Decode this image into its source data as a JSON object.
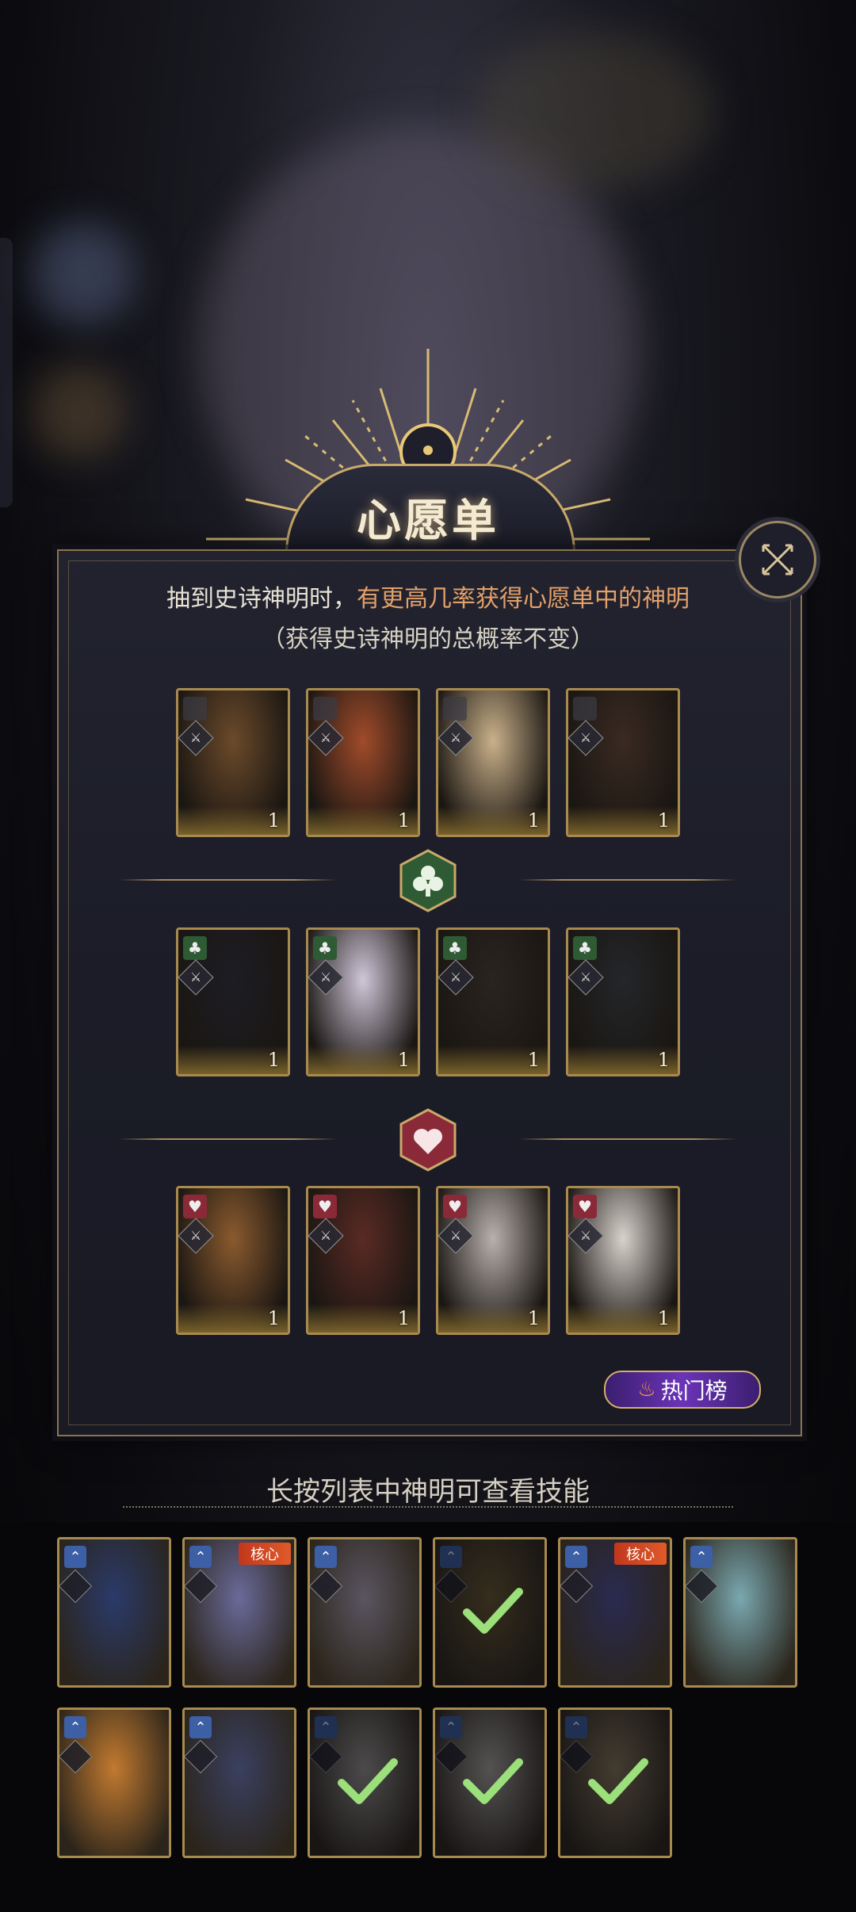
{
  "title": "心愿单",
  "description": {
    "line1_normal": "抽到史诗神明时，",
    "line1_highlight": "有更高几率获得心愿单中的神明",
    "line2": "（获得史诗神明的总概率不变）"
  },
  "wishlist_rows": [
    {
      "suit": "none",
      "cards": [
        {
          "count": "1",
          "tone": "#6b4a2a"
        },
        {
          "count": "1",
          "tone": "#a04b2a"
        },
        {
          "count": "1",
          "tone": "#c9b08a"
        },
        {
          "count": "1",
          "tone": "#3a2a22"
        }
      ]
    },
    {
      "suit": "club",
      "cards": [
        {
          "count": "1",
          "tone": "#1d1d24"
        },
        {
          "count": "1",
          "tone": "#cfc6d8"
        },
        {
          "count": "1",
          "tone": "#2a2420"
        },
        {
          "count": "1",
          "tone": "#24262a"
        }
      ]
    },
    {
      "suit": "heart",
      "cards": [
        {
          "count": "1",
          "tone": "#8a5a2e"
        },
        {
          "count": "1",
          "tone": "#5a2a24"
        },
        {
          "count": "1",
          "tone": "#b8b0ac"
        },
        {
          "count": "1",
          "tone": "#d8d2cc"
        }
      ]
    }
  ],
  "hot_list_button": "热门榜",
  "hint": "长按列表中神明可查看技能",
  "core_badge": "核心",
  "god_list": [
    {
      "tone": "#2a3a6a",
      "core": false,
      "selected": false
    },
    {
      "tone": "#6a6a9a",
      "core": true,
      "selected": false
    },
    {
      "tone": "#5a5560",
      "core": false,
      "selected": false
    },
    {
      "tone": "#6b5a30",
      "core": false,
      "selected": true
    },
    {
      "tone": "#2a2a50",
      "core": true,
      "selected": false
    },
    {
      "tone": "#7aa8b0",
      "core": false,
      "selected": false
    },
    {
      "tone": "#c27a30",
      "core": false,
      "selected": false
    },
    {
      "tone": "#3a4060",
      "core": false,
      "selected": false
    },
    {
      "tone": "#a09a96",
      "core": false,
      "selected": true
    },
    {
      "tone": "#b0aaa4",
      "core": false,
      "selected": true
    },
    {
      "tone": "#8a7a5a",
      "core": false,
      "selected": true
    }
  ],
  "colors": {
    "gold": "#c9a96a",
    "club_badge": "#2e5a34",
    "heart_badge": "#8a2a38",
    "highlight_text": "#e3a06a",
    "check": "#9be07a"
  }
}
